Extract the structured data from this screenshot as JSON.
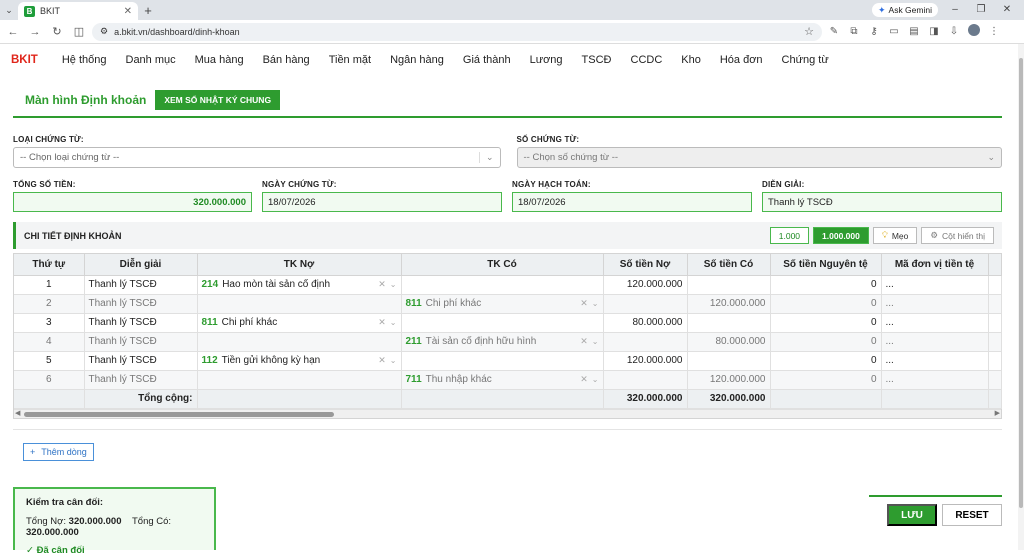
{
  "browser": {
    "tab_title": "BKIT",
    "favicon_letter": "B",
    "url": "a.bkit.vn/dashboard/dinh-khoan",
    "gemini_label": "Ask Gemini"
  },
  "nav": {
    "brand": "BKIT",
    "items": [
      "Hệ thống",
      "Danh mục",
      "Mua hàng",
      "Bán hàng",
      "Tiền mặt",
      "Ngân hàng",
      "Giá thành",
      "Lương",
      "TSCĐ",
      "CCDC",
      "Kho",
      "Hóa đơn",
      "Chứng từ"
    ]
  },
  "header": {
    "title": "Màn hình Định khoản",
    "journal_button": "XEM SỔ NHẬT KÝ CHUNG"
  },
  "form": {
    "voucher_type_label": "LOẠI CHỨNG TỪ:",
    "voucher_type_placeholder": "-- Chọn loại chứng từ --",
    "voucher_no_label": "SỐ CHỨNG TỪ:",
    "voucher_no_placeholder": "-- Chọn số chứng từ --",
    "total_label": "TỔNG SỐ TIỀN:",
    "total_value": "320.000.000",
    "voucher_date_label": "NGÀY CHỨNG TỪ:",
    "voucher_date_value": "18/07/2026",
    "posting_date_label": "NGÀY HẠCH TOÁN:",
    "posting_date_value": "18/07/2026",
    "description_label": "DIỄN GIẢI:",
    "description_value": "Thanh lý TSCĐ"
  },
  "detail": {
    "title": "CHI TIẾT ĐỊNH KHOẢN",
    "tool_1000": "1.000",
    "tool_1000000": "1.000.000",
    "tool_tips": "Mẹo",
    "tool_columns": "Cột hiển thị"
  },
  "table": {
    "headers": [
      "Thứ tự",
      "Diễn giải",
      "TK Nợ",
      "TK Có",
      "Số tiền Nợ",
      "Số tiền Có",
      "Số tiền Nguyên tệ",
      "Mã đơn vị tiền tệ"
    ],
    "rows": [
      {
        "no": "1",
        "desc": "Thanh lý TSCĐ",
        "debit_code": "214",
        "debit_name": "Hao mòn tài sản cố định",
        "credit_code": "",
        "credit_name": "",
        "debit_amt": "120.000.000",
        "credit_amt": "",
        "fx_amt": "0",
        "currency": "..."
      },
      {
        "no": "2",
        "desc": "Thanh lý TSCĐ",
        "debit_code": "",
        "debit_name": "",
        "credit_code": "811",
        "credit_name": "Chi phí khác",
        "debit_amt": "",
        "credit_amt": "120.000.000",
        "fx_amt": "0",
        "currency": "..."
      },
      {
        "no": "3",
        "desc": "Thanh lý TSCĐ",
        "debit_code": "811",
        "debit_name": "Chi phí khác",
        "credit_code": "",
        "credit_name": "",
        "debit_amt": "80.000.000",
        "credit_amt": "",
        "fx_amt": "0",
        "currency": "..."
      },
      {
        "no": "4",
        "desc": "Thanh lý TSCĐ",
        "debit_code": "",
        "debit_name": "",
        "credit_code": "211",
        "credit_name": "Tài sản cố định hữu hình",
        "debit_amt": "",
        "credit_amt": "80.000.000",
        "fx_amt": "0",
        "currency": "..."
      },
      {
        "no": "5",
        "desc": "Thanh lý TSCĐ",
        "debit_code": "112",
        "debit_name": "Tiền gửi không kỳ hạn",
        "credit_code": "",
        "credit_name": "",
        "debit_amt": "120.000.000",
        "credit_amt": "",
        "fx_amt": "0",
        "currency": "..."
      },
      {
        "no": "6",
        "desc": "Thanh lý TSCĐ",
        "debit_code": "",
        "debit_name": "",
        "credit_code": "711",
        "credit_name": "Thu nhập khác",
        "debit_amt": "",
        "credit_amt": "120.000.000",
        "fx_amt": "0",
        "currency": "..."
      }
    ],
    "total_label": "Tổng cộng:",
    "total_debit": "320.000.000",
    "total_credit": "320.000.000"
  },
  "add_row_label": "Thêm dòng",
  "balance": {
    "title": "Kiểm tra cân đối:",
    "debit_label": "Tổng Nợ:",
    "debit_value": "320.000.000",
    "credit_label": "Tổng Có:",
    "credit_value": "320.000.000",
    "status": "Đã cân đối"
  },
  "actions": {
    "save": "LƯU",
    "reset": "RESET"
  }
}
